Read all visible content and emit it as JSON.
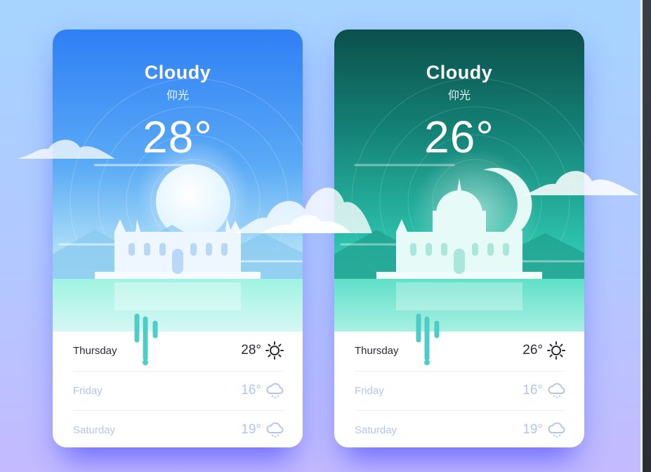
{
  "cards": [
    {
      "condition": "Cloudy",
      "location": "仰光",
      "temperature": "28°",
      "forecast": [
        {
          "day": "Thursday",
          "temp": "28°",
          "icon": "sun-icon"
        },
        {
          "day": "Friday",
          "temp": "16°",
          "icon": "rain-cloud-icon"
        },
        {
          "day": "Saturday",
          "temp": "19°",
          "icon": "rain-cloud-icon"
        }
      ]
    },
    {
      "condition": "Cloudy",
      "location": "仰光",
      "temperature": "26°",
      "forecast": [
        {
          "day": "Thursday",
          "temp": "26°",
          "icon": "sun-icon"
        },
        {
          "day": "Friday",
          "temp": "16°",
          "icon": "rain-cloud-icon"
        },
        {
          "day": "Saturday",
          "temp": "19°",
          "icon": "rain-cloud-icon"
        }
      ]
    }
  ],
  "colors": {
    "day_sky_top": "#2f7ff5",
    "day_sky_bottom": "#bfeaf8",
    "night_sky_top": "#0b4f4b",
    "night_sky_bottom": "#4fd8c2",
    "accent_teal": "#4ecdc8",
    "forecast_dim_text": "#b3c5ee"
  }
}
